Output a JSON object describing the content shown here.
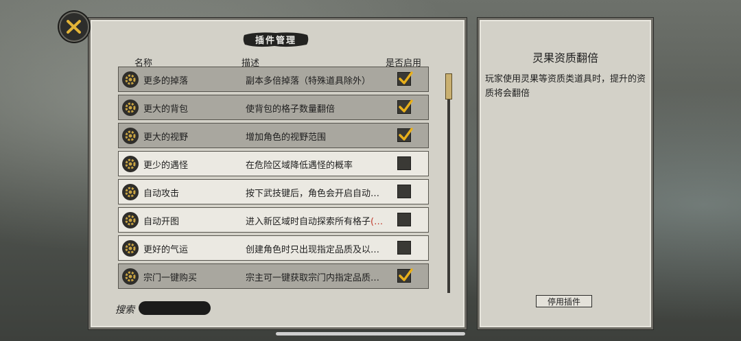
{
  "header": {
    "title": "插件管理"
  },
  "columns": {
    "name": "名称",
    "description": "描述",
    "enabled": "是否启用"
  },
  "plugins": [
    {
      "name": "更多的掉落",
      "description": "副本多倍掉落（特殊道具除外）",
      "enabled": true
    },
    {
      "name": "更大的背包",
      "description": "使背包的格子数量翻倍",
      "enabled": true
    },
    {
      "name": "更大的视野",
      "description": "增加角色的视野范围",
      "enabled": true
    },
    {
      "name": "更少的遇怪",
      "description": "在危险区域降低遇怪的概率",
      "enabled": false
    },
    {
      "name": "自动攻击",
      "description": "按下武技键后，角色会开启自动…",
      "enabled": false
    },
    {
      "name": "自动开图",
      "description": "进入新区域时自动探索所有格子",
      "description_suffix": "(…",
      "enabled": false
    },
    {
      "name": "更好的气运",
      "description": "创建角色时只出现指定品质及以…",
      "enabled": false
    },
    {
      "name": "宗门一键购买",
      "description": "宗主可一键获取宗门内指定品质…",
      "enabled": true
    }
  ],
  "search": {
    "label": "搜索",
    "value": ""
  },
  "detail": {
    "title": "灵果资质翻倍",
    "description": "玩家使用灵果等资质类道具时，提升的资质将会翻倍",
    "disable_button": "停用插件"
  },
  "scroll": {
    "position": 0.0
  },
  "icons": {
    "close": "close-icon",
    "plugin": "gear-icon",
    "check": "checkmark-icon"
  },
  "colors": {
    "enabled_row": "#a9a79f",
    "disabled_row": "#ebe9e2",
    "check": "#e8b01c"
  }
}
